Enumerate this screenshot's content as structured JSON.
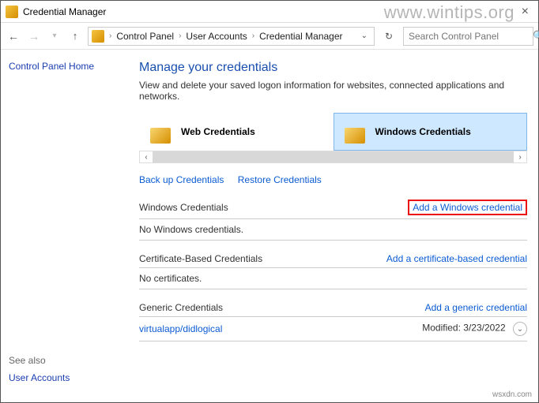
{
  "window": {
    "title": "Credential Manager",
    "watermark": "www.wintips.org",
    "watermark2": "wsxdn.com"
  },
  "nav": {
    "breadcrumb": [
      "Control Panel",
      "User Accounts",
      "Credential Manager"
    ],
    "search_placeholder": "Search Control Panel"
  },
  "sidebar": {
    "home": "Control Panel Home",
    "seealso_label": "See also",
    "seealso_link": "User Accounts"
  },
  "page": {
    "title": "Manage your credentials",
    "subtitle": "View and delete your saved logon information for websites, connected applications and networks.",
    "tabs": {
      "web": "Web Credentials",
      "windows": "Windows Credentials"
    },
    "actions": {
      "backup": "Back up Credentials",
      "restore": "Restore Credentials"
    },
    "sections": {
      "windows": {
        "header": "Windows Credentials",
        "add": "Add a Windows credential",
        "empty": "No Windows credentials."
      },
      "cert": {
        "header": "Certificate-Based Credentials",
        "add": "Add a certificate-based credential",
        "empty": "No certificates."
      },
      "generic": {
        "header": "Generic Credentials",
        "add": "Add a generic credential",
        "item_name": "virtualapp/didlogical",
        "item_modified_label": "Modified:",
        "item_modified_value": "3/23/2022"
      }
    }
  }
}
